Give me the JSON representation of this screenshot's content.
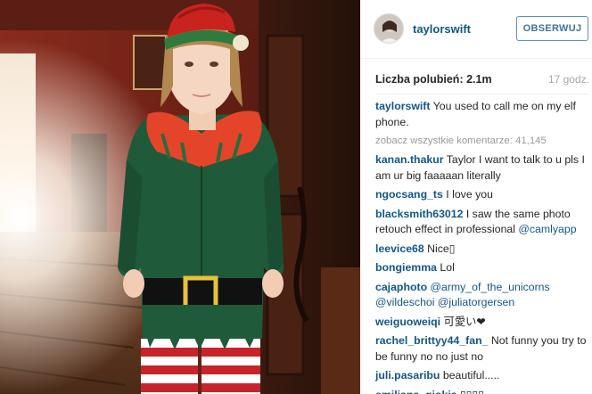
{
  "header": {
    "username": "taylorswift",
    "follow_label": "OBSERWUJ"
  },
  "stats": {
    "likes_label": "Liczba polubień: 2.1m",
    "time": "17 godz."
  },
  "caption": {
    "user": "taylorswift",
    "text": " You used to call me on my elf phone."
  },
  "view_all": {
    "label": "zobacz wszystkie komentarze: 41,145"
  },
  "comments": [
    {
      "user": "kanan.thakur",
      "text": " Taylor I want to talk to u pls I am ur big faaaaan literally"
    },
    {
      "user": "ngocsang_ts",
      "text": " I love you"
    },
    {
      "user": "blacksmith63012",
      "text": " I saw the same photo retouch effect in professional ",
      "mention": "@camlyapp"
    },
    {
      "user": "leevice68",
      "text": " Nice▯"
    },
    {
      "user": "bongiemma",
      "text": " Lol"
    },
    {
      "user": "cajaphoto",
      "text": " ",
      "mention": "@army_of_the_unicorns @vildeschoi @juliatorgersen"
    },
    {
      "user": "weiguoweiqi",
      "text": " 可愛い❤"
    },
    {
      "user": "rachel_brittyy44_fan_",
      "text": " Not funny you try to be funny no no just no"
    },
    {
      "user": "juli.pasaribu",
      "text": " beautiful....."
    },
    {
      "user": "emiliana_gjokja",
      "text": " ▯▯▯▯"
    }
  ],
  "colors": {
    "username_blue": "#125688",
    "follow_border": "#5f8fb7",
    "muted": "#a5a7aa"
  }
}
